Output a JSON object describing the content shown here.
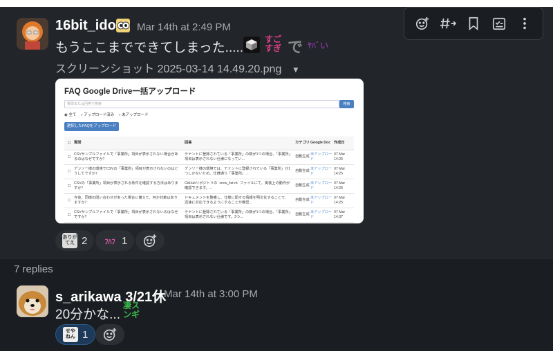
{
  "message1": {
    "author": "16bit_idol",
    "timestamp": "Mar 14th at 2:49 PM",
    "text": "もうここまでできてしまった......",
    "emoji_sugoi": "すご\nすぎ",
    "emoji_de": "で",
    "emoji_yabai": "ﾔﾊﾞい",
    "filename": "スクリーンショット 2025-03-14 14.49.20.png",
    "attachment": {
      "title": "FAQ Google Drive一括アップロード",
      "search_placeholder": "質問または回答で検索",
      "search_button": "検索",
      "radios": [
        "全て",
        "アップロード済み",
        "未アップロード"
      ],
      "upload_button": "選択したFAQをアップロード",
      "columns": [
        "質問",
        "回答",
        "カテゴリ",
        "Google Doc",
        "作成日"
      ],
      "rows": [
        {
          "q": "CSVサンプルファイルで「事業所」項目が表示されない場合があるのはなぜですか？",
          "a": "テナントに登録されている「事業所」の数が1つの場合、「事業所」項目は表示されない仕様になってい...",
          "cat": "自動生成",
          "doc": "未アップロード",
          "date": "07 Mar 14:25"
        },
        {
          "q": "デンソー様の環境でCSVの「事業所」項目が表示されないのはどうしてですか？",
          "a": "デンソー様の環境では、テナントに登録されている「事業所」が1つしかないため、仕様通り「事業所」...",
          "cat": "自動生成",
          "doc": "未アップロード",
          "date": "07 Mar 14:25"
        },
        {
          "q": "CSVの「事業所」項目が表示される条件を確認する方法はありますか？",
          "a": "GitHubリポジトリの `crew_list.rb` ファイルにて、実装上の動作が確認できます。...",
          "cat": "自動生成",
          "doc": "未アップロード",
          "date": "07 Mar 14:25"
        },
        {
          "q": "今後、同様の問い合わせがあった場合に備えて、何か対策はありますか？",
          "a": "ドキュメントを整備し、仕様に関する情報を明文化することで、迅速に対応できるようにすることが推奨...",
          "cat": "自動生成",
          "doc": "未アップロード",
          "date": "07 Mar 14:25"
        },
        {
          "q": "CSVサンプルファイルで「事業所」項目が表示されないのはなぜですか？",
          "a": "テナントに登録されている「事業所」の数が1つの場合、「事業所」項目は表示されない仕様です。2つ...",
          "cat": "自動生成",
          "doc": "未アップロード",
          "date": "07 Mar 14:37"
        }
      ]
    },
    "reactions": [
      {
        "emoji_text": "ありがてえ",
        "count": "2"
      },
      {
        "emoji_text": "ﾌﾊﾌ",
        "count": "1"
      }
    ]
  },
  "replies_label": "7 replies",
  "message2": {
    "author": "s_arikawa 3/21休",
    "timestamp": "Mar 14th at 3:00 PM",
    "text": "20分かな...",
    "emoji_text": "凄ス\nンギ",
    "reactions": [
      {
        "emoji_text": "せや\nねん",
        "count": "1"
      }
    ]
  },
  "colors": {
    "background": "#1a1d21",
    "hover_background": "#222529",
    "accent": "#2c5a88"
  },
  "icons": {
    "toolbar": [
      "add-reaction-icon",
      "forward-to-channel-icon",
      "bookmark-icon",
      "save-for-later-icon",
      "more-actions-icon"
    ]
  }
}
